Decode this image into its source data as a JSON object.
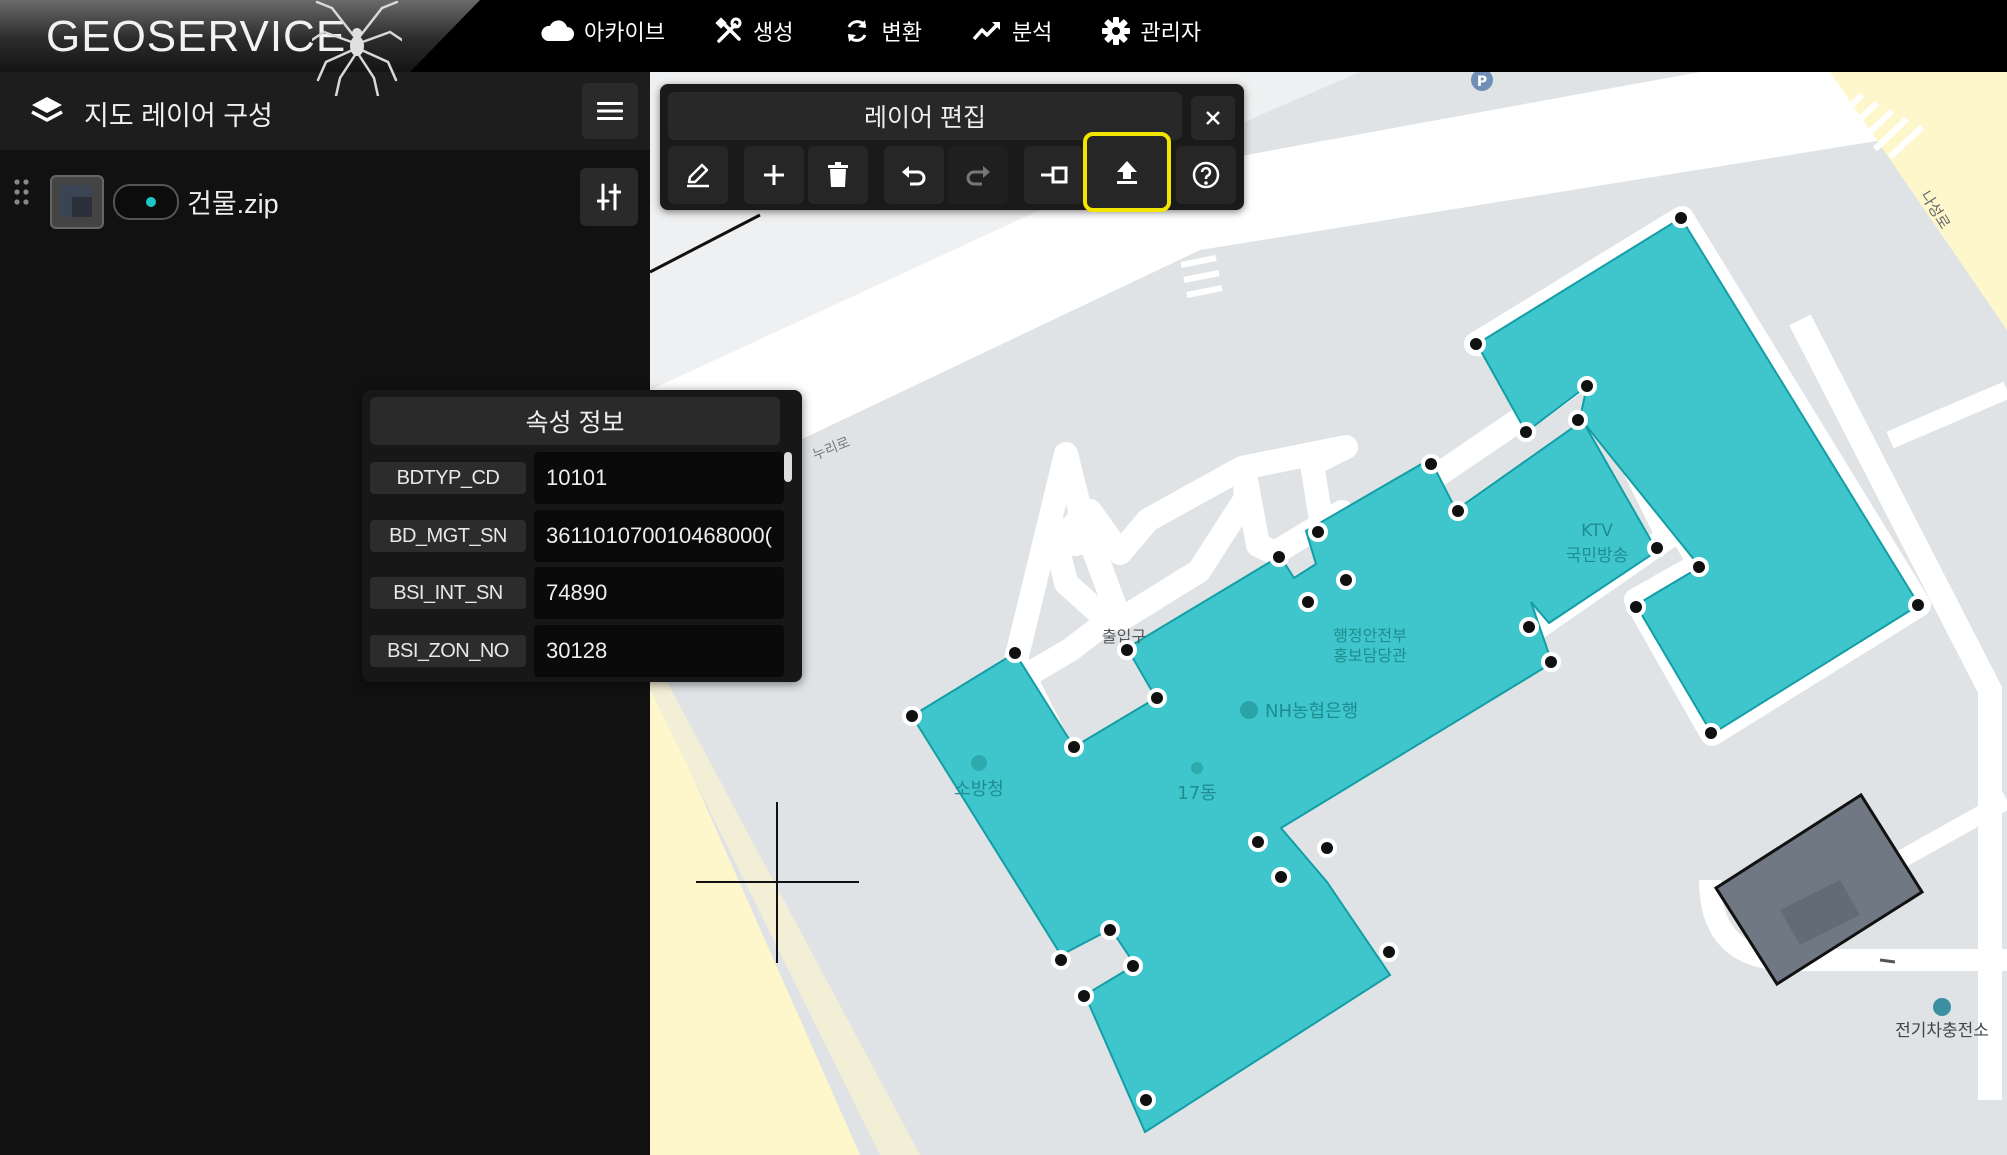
{
  "app": {
    "logo": "GEOSERVICE"
  },
  "nav": [
    {
      "label": "아카이브",
      "icon": "cloud-icon"
    },
    {
      "label": "생성",
      "icon": "tools-icon"
    },
    {
      "label": "변환",
      "icon": "refresh-icon"
    },
    {
      "label": "분석",
      "icon": "trend-icon"
    },
    {
      "label": "관리자",
      "icon": "gear-icon"
    }
  ],
  "sidebar": {
    "title": "지도 레이어 구성",
    "layer": {
      "name": "건물.zip",
      "visible": true
    }
  },
  "edit_panel": {
    "title": "레이어 편집",
    "tools": [
      "pencil-icon",
      "plus-icon",
      "trash-icon",
      "undo-icon",
      "redo-icon",
      "split-icon",
      "upload-icon",
      "help-icon"
    ],
    "highlighted_tool": "upload-icon"
  },
  "attr_panel": {
    "title": "속성 정보",
    "rows": [
      {
        "key": "BDTYP_CD",
        "value": "10101"
      },
      {
        "key": "BD_MGT_SN",
        "value": "361101070010468000("
      },
      {
        "key": "BSI_INT_SN",
        "value": "74890"
      },
      {
        "key": "BSI_ZON_NO",
        "value": "30128"
      }
    ]
  },
  "map": {
    "labels": {
      "road_east": "나성로",
      "road_north": "누리로",
      "entrance": "출입구",
      "ktv": "KTV",
      "ktv2": "국민방송",
      "mois1": "행정안전부",
      "mois2": "홍보담당관",
      "bank": "NH농협은행",
      "fire": "소방청",
      "dong": "17동",
      "ev": "전기차충전소",
      "parking": "P"
    },
    "colors": {
      "polygon_fill": "#3ec6cc",
      "polygon_stroke": "#139ea6",
      "land": "#e0e3e5",
      "road": "#fff6c8"
    }
  }
}
